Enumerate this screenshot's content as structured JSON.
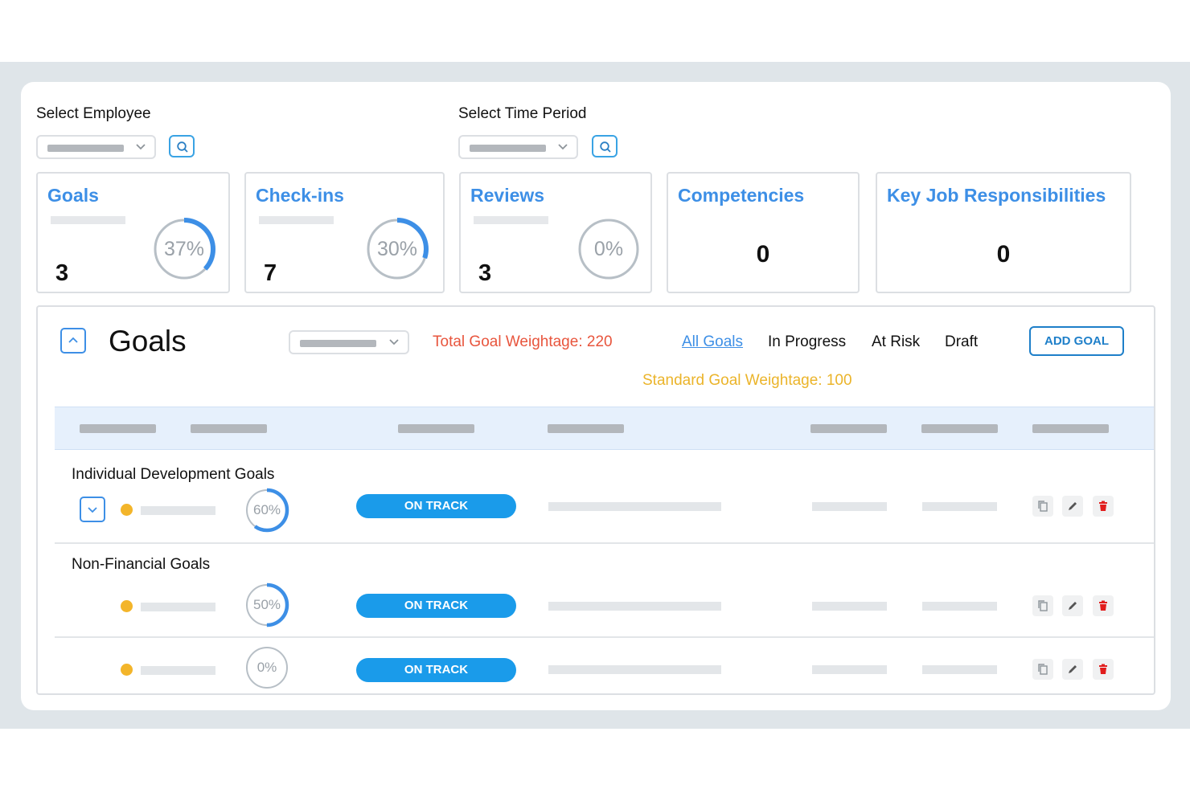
{
  "filters": {
    "employee_label": "Select Employee",
    "time_period_label": "Select Time Period"
  },
  "stats": [
    {
      "title": "Goals",
      "count": "3",
      "percent": 37,
      "percent_text": "37%"
    },
    {
      "title": "Check-ins",
      "count": "7",
      "percent": 30,
      "percent_text": "30%"
    },
    {
      "title": "Reviews",
      "count": "3",
      "percent": 0,
      "percent_text": "0%"
    },
    {
      "title": "Competencies",
      "count": "0"
    },
    {
      "title": "Key Job Responsibilities",
      "count": "0"
    }
  ],
  "goals_panel": {
    "title": "Goals",
    "total_weightage": "Total Goal Weightage: 220",
    "standard_weightage": "Standard Goal Weightage: 100",
    "tabs": [
      "All Goals",
      "In Progress",
      "At Risk",
      "Draft"
    ],
    "active_tab": "All Goals",
    "add_button": "ADD GOAL"
  },
  "groups": [
    {
      "label": "Individual Development Goals",
      "rows": [
        {
          "percent": 60,
          "percent_text": "60%",
          "status": "ON TRACK"
        }
      ]
    },
    {
      "label": "Non-Financial Goals",
      "rows": [
        {
          "percent": 50,
          "percent_text": "50%",
          "status": "ON TRACK"
        },
        {
          "percent": 0,
          "percent_text": "0%",
          "status": "ON TRACK"
        }
      ]
    }
  ],
  "colors": {
    "accent": "#3d8fe6",
    "ring_track": "#b7bfc6",
    "status_on_track": "#1a9bea",
    "total_weightage": "#e8553d",
    "standard_weightage": "#ebb42a",
    "delete": "#e11d1d"
  },
  "icons": [
    "search-icon",
    "chevron-down-icon",
    "chevron-up-icon",
    "copy-icon",
    "edit-icon",
    "delete-icon"
  ]
}
